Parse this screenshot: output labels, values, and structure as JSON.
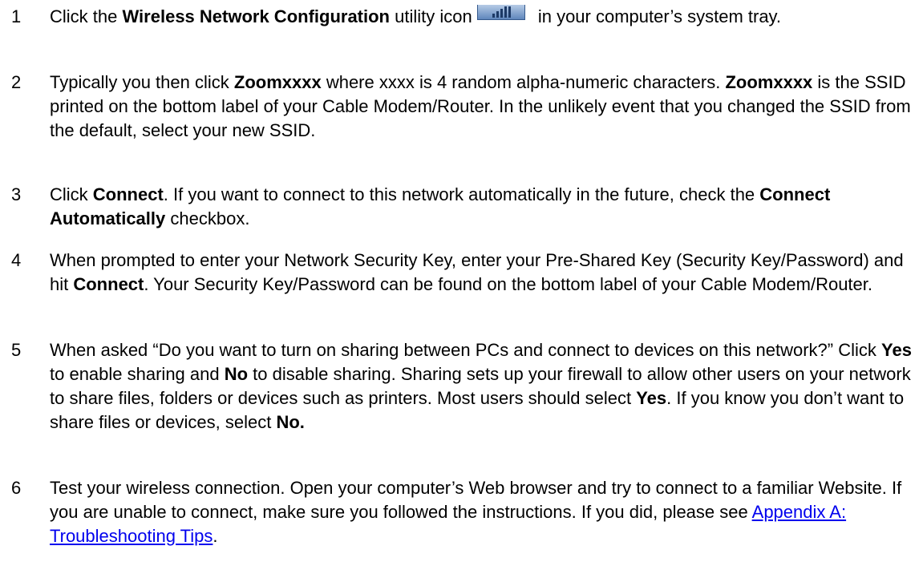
{
  "steps": [
    {
      "number": "1",
      "before": "Click the ",
      "bold1": "Wireless Network Configuration",
      "mid": " utility icon",
      "after": " in your computer’s system tray.",
      "icon": "wireless-signal-tray-icon"
    },
    {
      "number": "2",
      "before": "Typically you then click ",
      "bold1": "Zoomxxxx",
      "mid": " where xxxx is 4 random alpha-numeric characters. ",
      "bold2": "Zoomxxxx",
      "after": " is the SSID printed on the bottom label of your Cable Modem/Router.   In the unlikely event that you changed the SSID from the default, select your new SSID."
    },
    {
      "number": "3",
      "before": "Click ",
      "bold1": "Connect",
      "mid": ". If you want to connect to this network automatically in the future, check the ",
      "bold2": "Connect Automatically",
      "after": " checkbox."
    },
    {
      "number": "4",
      "before": "When prompted to enter your Network Security Key, enter your Pre-Shared Key (Security Key/Password) and hit ",
      "bold1": "Connect",
      "after": ". Your Security Key/Password can be found on the bottom label of your Cable Modem/Router."
    },
    {
      "number": "5",
      "before": "When asked “Do you want to turn on sharing between PCs and connect to devices on this network?” Click ",
      "bold1": "Yes",
      "mid": " to enable sharing and ",
      "bold2": "No",
      "mid2": " to disable sharing. Sharing sets up your firewall to allow other users on your network to share files, folders or devices such as printers.   Most users should select ",
      "bold3": "Yes",
      "mid3": ". If you know you don’t want to share files or devices, select ",
      "bold4": "No."
    },
    {
      "number": "6",
      "before": "Test your wireless connection. Open your computer’s Web browser and try to connect to a familiar Website.   If you are unable to connect, make sure you followed the instructions.   If you did, please see ",
      "link": "Appendix A: Troubleshooting Tips",
      "after": "."
    }
  ]
}
